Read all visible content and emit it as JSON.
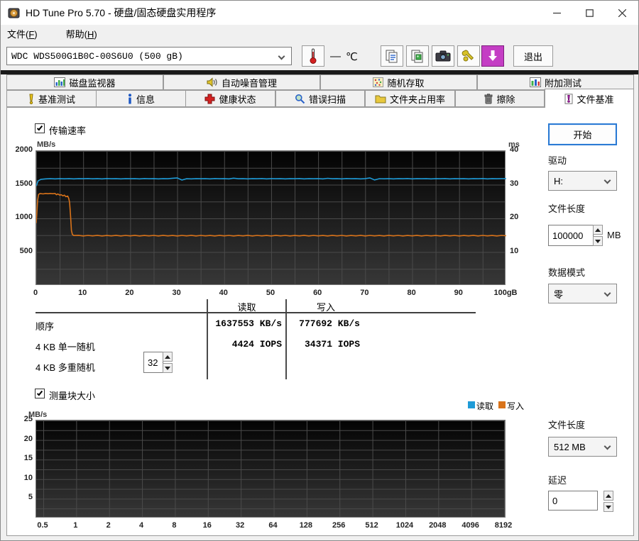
{
  "window": {
    "title": "HD Tune Pro 5.70 - 硬盘/固态硬盘实用程序",
    "controls": {
      "minimize": "─",
      "maximize": "□",
      "close": "✕"
    }
  },
  "menubar": {
    "items": [
      {
        "pre": "文件(",
        "key": "F",
        "post": ")"
      },
      {
        "pre": "帮助(",
        "key": "H",
        "post": ")"
      }
    ]
  },
  "toolbar": {
    "drive_select": "WDC WDS500G1B0C-00S6U0 (500 gB)",
    "temp_dash": "—",
    "temp_unit": "℃",
    "buttons": [
      "thermometer",
      "copy-text",
      "copy-image",
      "screenshot",
      "options",
      "download"
    ],
    "exit_button": "退出"
  },
  "tabs_row1": [
    {
      "label": "磁盘监视器",
      "icon": "disk-monitor-icon"
    },
    {
      "label": "自动噪音管理",
      "icon": "noise-management-icon"
    },
    {
      "label": "随机存取",
      "icon": "random-access-icon"
    },
    {
      "label": "附加测试",
      "icon": "extra-tests-icon"
    }
  ],
  "tabs_row2": [
    {
      "label": "基准测试",
      "icon": "benchmark-icon"
    },
    {
      "label": "信息",
      "icon": "info-icon"
    },
    {
      "label": "健康状态",
      "icon": "health-icon"
    },
    {
      "label": "错误扫描",
      "icon": "error-scan-icon"
    },
    {
      "label": "文件夹占用率",
      "icon": "folder-usage-icon"
    },
    {
      "label": "擦除",
      "icon": "erase-icon"
    },
    {
      "label": "文件基准",
      "icon": "file-benchmark-icon",
      "active": true
    }
  ],
  "main": {
    "transfer_rate_label": "传输速率",
    "block_size_label": "测量块大小"
  },
  "results_table": {
    "col_headers": [
      "读取",
      "写入"
    ],
    "rows": [
      {
        "label": "顺序",
        "read": "1637553 KB/s",
        "write": "777692 KB/s"
      },
      {
        "label": "4 KB 单一随机",
        "read": "4424 IOPS",
        "write": "34371 IOPS"
      },
      {
        "label": "4 KB 多重随机",
        "read": "",
        "write": "",
        "spinner": "32"
      }
    ]
  },
  "right_panel": {
    "start_button": "开始",
    "drive_label": "驱动",
    "drive_value": "H:",
    "file_length_label": "文件长度",
    "file_length_value": "100000",
    "file_length_unit": "MB",
    "data_mode_label": "数据模式",
    "data_mode_value": "零",
    "block_file_length_label": "文件长度",
    "block_file_length_value": "512 MB",
    "delay_label": "延迟",
    "delay_value": "0"
  },
  "chart_data": [
    {
      "type": "line",
      "title": "传输速率",
      "ylabel_left": "MB/s",
      "ylabel_right": "ms",
      "ylim_left": [
        0,
        2000
      ],
      "ylim_right": [
        0,
        40
      ],
      "xlim": [
        0,
        100
      ],
      "x_tick_labels": [
        "0",
        "10",
        "20",
        "30",
        "40",
        "50",
        "60",
        "70",
        "80",
        "90",
        "100gB"
      ],
      "y_ticks_left": [
        2000,
        1500,
        1000,
        500
      ],
      "y_ticks_right": [
        40,
        30,
        20,
        10
      ],
      "grid": true,
      "series": [
        {
          "name": "读取",
          "color": "#1f9bd7",
          "points": [
            [
              0,
              1480
            ],
            [
              0.4,
              1556
            ],
            [
              1,
              1580
            ],
            [
              2,
              1586
            ],
            [
              3,
              1590
            ],
            [
              4,
              1586
            ],
            [
              5,
              1591
            ],
            [
              6,
              1587
            ],
            [
              7,
              1590
            ],
            [
              8,
              1586
            ],
            [
              9,
              1591
            ],
            [
              10,
              1588
            ],
            [
              11,
              1592
            ],
            [
              12,
              1587
            ],
            [
              13,
              1590
            ],
            [
              14,
              1586
            ],
            [
              15,
              1592
            ],
            [
              16,
              1588
            ],
            [
              17,
              1590
            ],
            [
              18,
              1586
            ],
            [
              19,
              1591
            ],
            [
              20,
              1588
            ],
            [
              21,
              1590
            ],
            [
              22,
              1586
            ],
            [
              23,
              1592
            ],
            [
              24,
              1588
            ],
            [
              25,
              1590
            ],
            [
              26,
              1586
            ],
            [
              27,
              1591
            ],
            [
              28,
              1588
            ],
            [
              29,
              1596
            ],
            [
              30,
              1601
            ],
            [
              31,
              1569
            ],
            [
              32,
              1588
            ],
            [
              33,
              1586
            ],
            [
              34,
              1591
            ],
            [
              35,
              1588
            ],
            [
              36,
              1590
            ],
            [
              37,
              1586
            ],
            [
              38,
              1592
            ],
            [
              39,
              1588
            ],
            [
              40,
              1590
            ],
            [
              41,
              1586
            ],
            [
              42,
              1597
            ],
            [
              43,
              1588
            ],
            [
              44,
              1591
            ],
            [
              45,
              1586
            ],
            [
              46,
              1590
            ],
            [
              47,
              1588
            ],
            [
              48,
              1592
            ],
            [
              49,
              1586
            ],
            [
              50,
              1590
            ],
            [
              51,
              1588
            ],
            [
              52,
              1591
            ],
            [
              53,
              1586
            ],
            [
              54,
              1590
            ],
            [
              55,
              1588
            ],
            [
              56,
              1592
            ],
            [
              57,
              1586
            ],
            [
              58,
              1590
            ],
            [
              59,
              1588
            ],
            [
              60,
              1591
            ],
            [
              61,
              1586
            ],
            [
              62,
              1595
            ],
            [
              63,
              1588
            ],
            [
              64,
              1590
            ],
            [
              65,
              1586
            ],
            [
              66,
              1592
            ],
            [
              67,
              1588
            ],
            [
              68,
              1590
            ],
            [
              69,
              1586
            ],
            [
              70,
              1591
            ],
            [
              71,
              1601
            ],
            [
              72,
              1571
            ],
            [
              73,
              1589
            ],
            [
              74,
              1587
            ],
            [
              75,
              1591
            ],
            [
              76,
              1586
            ],
            [
              77,
              1590
            ],
            [
              78,
              1588
            ],
            [
              79,
              1592
            ],
            [
              80,
              1586
            ],
            [
              81,
              1590
            ],
            [
              82,
              1588
            ],
            [
              83,
              1591
            ],
            [
              84,
              1586
            ],
            [
              85,
              1590
            ],
            [
              86,
              1588
            ],
            [
              87,
              1592
            ],
            [
              88,
              1586
            ],
            [
              89,
              1590
            ],
            [
              90,
              1588
            ],
            [
              91,
              1591
            ],
            [
              92,
              1586
            ],
            [
              93,
              1590
            ],
            [
              94,
              1588
            ],
            [
              95,
              1592
            ],
            [
              96,
              1586
            ],
            [
              97,
              1590
            ],
            [
              98,
              1588
            ],
            [
              99,
              1590
            ],
            [
              100,
              1589
            ]
          ]
        },
        {
          "name": "写入",
          "color": "#d9731a",
          "points": [
            [
              0,
              930
            ],
            [
              0.3,
              1270
            ],
            [
              0.5,
              1355
            ],
            [
              0.8,
              1368
            ],
            [
              1.5,
              1363
            ],
            [
              2,
              1370
            ],
            [
              2.5,
              1366
            ],
            [
              3,
              1371
            ],
            [
              3.5,
              1366
            ],
            [
              4,
              1370
            ],
            [
              4.3,
              1352
            ],
            [
              4.6,
              1363
            ],
            [
              5,
              1345
            ],
            [
              5.3,
              1352
            ],
            [
              5.7,
              1335
            ],
            [
              6,
              1345
            ],
            [
              6.3,
              1322
            ],
            [
              6.7,
              1330
            ],
            [
              6.9,
              1300
            ],
            [
              7.1,
              1240
            ],
            [
              7.3,
              1050
            ],
            [
              7.5,
              820
            ],
            [
              7.7,
              760
            ],
            [
              8,
              745
            ],
            [
              9,
              748
            ],
            [
              10,
              739
            ],
            [
              11,
              747
            ],
            [
              12,
              740
            ],
            [
              13,
              748
            ],
            [
              14,
              739
            ],
            [
              15,
              746
            ],
            [
              16,
              740
            ],
            [
              17,
              748
            ],
            [
              18,
              739
            ],
            [
              19,
              747
            ],
            [
              20,
              740
            ],
            [
              21,
              748
            ],
            [
              22,
              739
            ],
            [
              23,
              746
            ],
            [
              24,
              740
            ],
            [
              25,
              747
            ],
            [
              26,
              739
            ],
            [
              27,
              748
            ],
            [
              28,
              740
            ],
            [
              29,
              746
            ],
            [
              30,
              739
            ],
            [
              31,
              747
            ],
            [
              32,
              740
            ],
            [
              33,
              748
            ],
            [
              34,
              739
            ],
            [
              35,
              747
            ],
            [
              36,
              740
            ],
            [
              37,
              746
            ],
            [
              38,
              739
            ],
            [
              39,
              748
            ],
            [
              40,
              740
            ],
            [
              41,
              747
            ],
            [
              42,
              739
            ],
            [
              43,
              746
            ],
            [
              44,
              740
            ],
            [
              45,
              748
            ],
            [
              46,
              739
            ],
            [
              47,
              747
            ],
            [
              48,
              740
            ],
            [
              49,
              746
            ],
            [
              50,
              739
            ],
            [
              51,
              748
            ],
            [
              52,
              740
            ],
            [
              53,
              747
            ],
            [
              54,
              739
            ],
            [
              55,
              746
            ],
            [
              56,
              740
            ],
            [
              57,
              748
            ],
            [
              58,
              739
            ],
            [
              59,
              747
            ],
            [
              60,
              740
            ],
            [
              61,
              746
            ],
            [
              62,
              739
            ],
            [
              63,
              748
            ],
            [
              64,
              740
            ],
            [
              65,
              747
            ],
            [
              66,
              739
            ],
            [
              67,
              746
            ],
            [
              68,
              740
            ],
            [
              69,
              748
            ],
            [
              70,
              739
            ],
            [
              71,
              747
            ],
            [
              72,
              740
            ],
            [
              73,
              746
            ],
            [
              74,
              739
            ],
            [
              75,
              748
            ],
            [
              76,
              740
            ],
            [
              77,
              747
            ],
            [
              78,
              739
            ],
            [
              79,
              746
            ],
            [
              80,
              740
            ],
            [
              81,
              748
            ],
            [
              82,
              739
            ],
            [
              83,
              747
            ],
            [
              84,
              740
            ],
            [
              85,
              746
            ],
            [
              86,
              739
            ],
            [
              87,
              748
            ],
            [
              88,
              740
            ],
            [
              89,
              747
            ],
            [
              90,
              739
            ],
            [
              91,
              746
            ],
            [
              92,
              740
            ],
            [
              93,
              748
            ],
            [
              94,
              739
            ],
            [
              95,
              747
            ],
            [
              96,
              740
            ],
            [
              97,
              746
            ],
            [
              98,
              739
            ],
            [
              99,
              747
            ],
            [
              100,
              742
            ]
          ]
        }
      ]
    },
    {
      "type": "bar",
      "title": "测量块大小",
      "ylabel": "MB/s",
      "ylim": [
        0,
        25
      ],
      "y_ticks": [
        25,
        20,
        15,
        10,
        5
      ],
      "categories": [
        "0.5",
        "1",
        "2",
        "4",
        "8",
        "16",
        "32",
        "64",
        "128",
        "256",
        "512",
        "1024",
        "2048",
        "4096",
        "8192"
      ],
      "grid": true,
      "legend_position": "top-right",
      "series": [
        {
          "name": "读取",
          "color": "#1f9bd7",
          "values": []
        },
        {
          "name": "写入",
          "color": "#d9731a",
          "values": []
        }
      ]
    }
  ]
}
